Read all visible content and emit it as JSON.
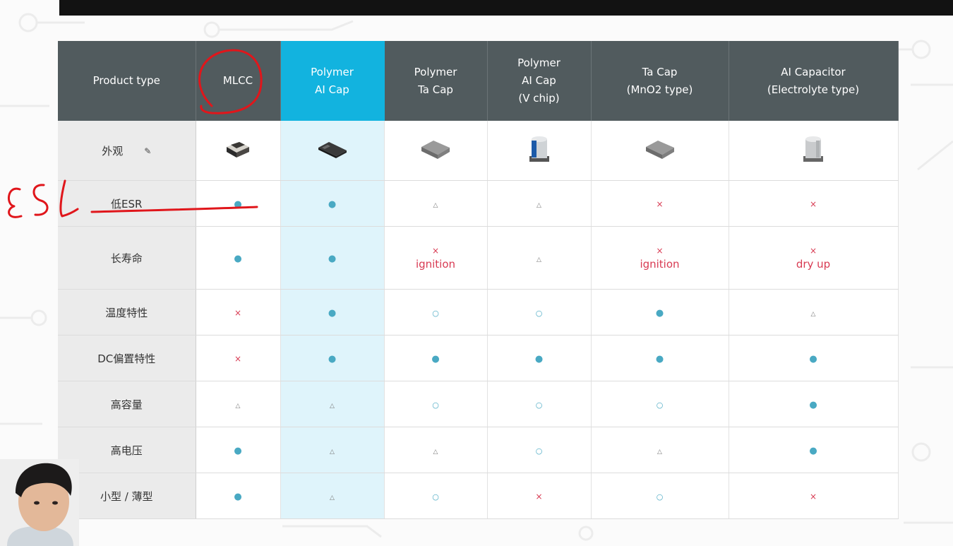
{
  "header": {
    "product_type": "Product type",
    "columns": [
      {
        "lines": [
          "MLCC"
        ]
      },
      {
        "lines": [
          "Polymer",
          "AI Cap"
        ]
      },
      {
        "lines": [
          "Polymer",
          "Ta Cap"
        ]
      },
      {
        "lines": [
          "Polymer",
          "AI Cap",
          "(V chip)"
        ]
      },
      {
        "lines": [
          "Ta Cap",
          "(MnO2 type)"
        ]
      },
      {
        "lines": [
          "AI Capacitor",
          "(Electrolyte type)"
        ]
      }
    ]
  },
  "rows": [
    {
      "label": "外观"
    },
    {
      "label": "低ESR"
    },
    {
      "label": "长寿命",
      "notes": [
        "",
        "",
        "ignition",
        "",
        "ignition",
        "dry up"
      ]
    },
    {
      "label": "温度特性"
    },
    {
      "label": "DC偏置特性"
    },
    {
      "label": "高容量"
    },
    {
      "label": "高电压"
    },
    {
      "label": "小型 / 薄型"
    }
  ],
  "marks": {
    "dot": "●",
    "circle": "○",
    "triangle": "△",
    "cross": "×"
  },
  "annotation": {
    "handwritten": "ESL",
    "color": "#e0161b"
  },
  "colors": {
    "header_bg": "#515b5e",
    "highlight_header": "#12b3df",
    "highlight_cell": "#dff4fb",
    "rowhead_bg": "#ebebeb",
    "mark_blue": "#49a9c3",
    "mark_red": "#d83a52"
  },
  "grid": [
    [
      "dot",
      "dot",
      "tri",
      "tri",
      "x",
      "x"
    ],
    [
      "dot",
      "dot",
      "x",
      "tri",
      "x",
      "x"
    ],
    [
      "x",
      "dot",
      "circ",
      "circ",
      "dot",
      "tri"
    ],
    [
      "x",
      "dot",
      "dot",
      "dot",
      "dot",
      "dot"
    ],
    [
      "tri",
      "tri",
      "circ",
      "circ",
      "circ",
      "dot"
    ],
    [
      "dot",
      "tri",
      "tri",
      "circ",
      "tri",
      "dot"
    ],
    [
      "dot",
      "tri",
      "circ",
      "x",
      "circ",
      "x"
    ]
  ]
}
